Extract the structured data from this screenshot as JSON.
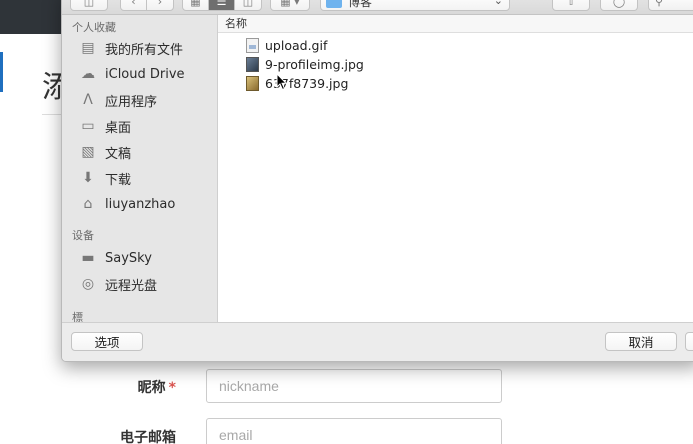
{
  "page": {
    "heading_char": "添",
    "form": {
      "nickname": {
        "label": "昵称",
        "required_mark": "*",
        "placeholder": "nickname"
      },
      "email": {
        "label": "电子邮箱",
        "placeholder": "email"
      }
    }
  },
  "dialog": {
    "toolbar": {
      "location": "博客"
    },
    "sidebar": {
      "favorites_header": "个人收藏",
      "favorites": [
        {
          "label": "我的所有文件",
          "icon": "all-files-icon"
        },
        {
          "label": "iCloud Drive",
          "icon": "cloud-icon"
        },
        {
          "label": "应用程序",
          "icon": "applications-icon"
        },
        {
          "label": "桌面",
          "icon": "desktop-icon"
        },
        {
          "label": "文稿",
          "icon": "documents-icon"
        },
        {
          "label": "下载",
          "icon": "downloads-icon"
        },
        {
          "label": "liuyanzhao",
          "icon": "home-icon"
        }
      ],
      "devices_header": "设备",
      "devices": [
        {
          "label": "SaySky",
          "icon": "laptop-icon"
        },
        {
          "label": "远程光盘",
          "icon": "disc-icon"
        }
      ],
      "cut_header": "標"
    },
    "file_list": {
      "column_name": "名称",
      "files": [
        {
          "name": "upload.gif",
          "icon": "gif-file-icon"
        },
        {
          "name": "9-profileimg.jpg",
          "icon": "image-file-icon"
        },
        {
          "name": "637f8739.jpg",
          "icon": "image-file-icon"
        }
      ]
    },
    "buttons": {
      "options": "选项",
      "cancel": "取消"
    }
  }
}
